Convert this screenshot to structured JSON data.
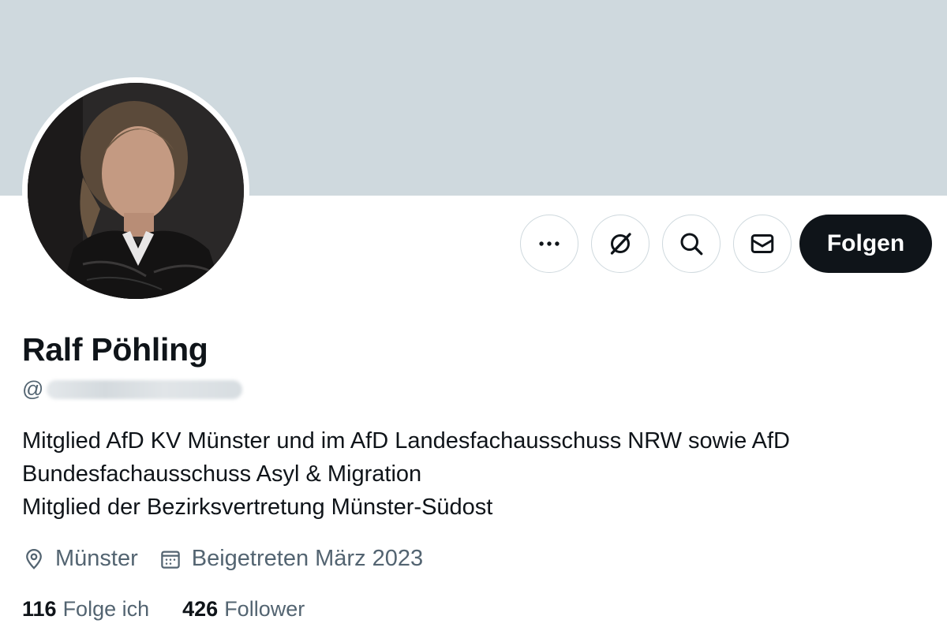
{
  "profile": {
    "display_name": "Ralf Pöhling",
    "handle_prefix": "@",
    "bio_lines": [
      "Mitglied AfD KV Münster und im AfD Landesfachausschuss NRW sowie AfD",
      "Bundesfachausschuss Asyl & Migration",
      "Mitglied der Bezirksvertretung Münster-Südost"
    ],
    "location": "Münster",
    "joined": "Beigetreten März 2023"
  },
  "actions": {
    "more_icon": "more-icon",
    "grok_icon": "grok-icon",
    "search_icon": "search-icon",
    "message_icon": "mail-icon",
    "follow_label": "Folgen"
  },
  "stats": {
    "following_count": "116",
    "following_label": "Folge ich",
    "followers_count": "426",
    "followers_label": "Follower"
  },
  "colors": {
    "banner": "#cfd9de",
    "primary_text": "#0f1419",
    "secondary_text": "#536471",
    "follow_button": "#0f1419",
    "border": "#cfd9de"
  }
}
